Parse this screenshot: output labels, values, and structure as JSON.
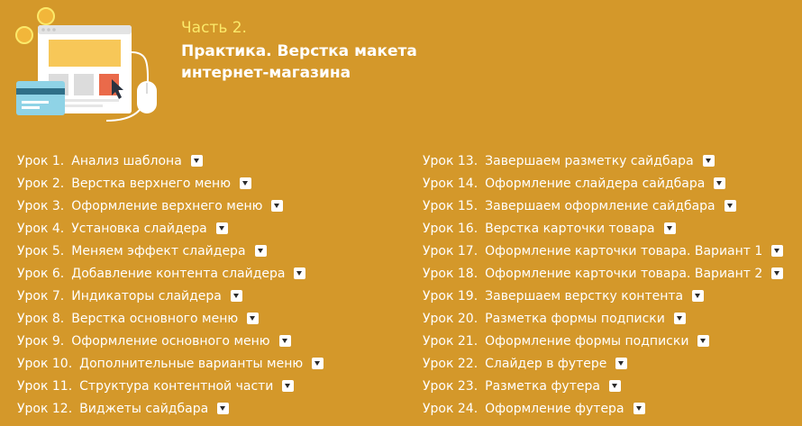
{
  "header": {
    "part": "Часть 2.",
    "title_line1": "Практика. Верстка макета",
    "title_line2": "интернет-магазина"
  },
  "lessons_left": [
    {
      "num": "Урок 1.",
      "title": "Анализ шаблона"
    },
    {
      "num": "Урок 2.",
      "title": "Верстка верхнего меню"
    },
    {
      "num": "Урок 3.",
      "title": "Оформление верхнего меню"
    },
    {
      "num": "Урок 4.",
      "title": "Установка слайдера"
    },
    {
      "num": "Урок 5.",
      "title": "Меняем эффект слайдера"
    },
    {
      "num": "Урок 6.",
      "title": "Добавление контента слайдера"
    },
    {
      "num": "Урок 7.",
      "title": "Индикаторы слайдера"
    },
    {
      "num": "Урок 8.",
      "title": "Верстка основного меню"
    },
    {
      "num": "Урок 9.",
      "title": "Оформление основного меню"
    },
    {
      "num": "Урок 10.",
      "title": "Дополнительные варианты меню"
    },
    {
      "num": "Урок 11.",
      "title": "Структура контентной части"
    },
    {
      "num": "Урок 12.",
      "title": "Виджеты сайдбара"
    }
  ],
  "lessons_right": [
    {
      "num": "Урок 13.",
      "title": "Завершаем разметку сайдбара"
    },
    {
      "num": "Урок 14.",
      "title": "Оформление слайдера сайдбара"
    },
    {
      "num": "Урок 15.",
      "title": "Завершаем оформление сайдбара"
    },
    {
      "num": "Урок 16.",
      "title": "Верстка карточки товара"
    },
    {
      "num": "Урок 17.",
      "title": "Оформление карточки товара. Вариант 1"
    },
    {
      "num": "Урок 18.",
      "title": "Оформление карточки товара. Вариант 2"
    },
    {
      "num": "Урок 19.",
      "title": "Завершаем верстку контента"
    },
    {
      "num": "Урок 20.",
      "title": "Разметка формы подписки"
    },
    {
      "num": "Урок 21.",
      "title": "Оформление формы подписки"
    },
    {
      "num": "Урок 22.",
      "title": "Слайдер в футере"
    },
    {
      "num": "Урок 23.",
      "title": "Разметка футера"
    },
    {
      "num": "Урок 24.",
      "title": "Оформление футера"
    }
  ],
  "icons": {
    "lesson_action": "download-icon",
    "hero": "ecommerce-illustration"
  },
  "colors": {
    "background": "#d4982a",
    "part_label": "#fbe96a",
    "text": "#ffffff"
  }
}
